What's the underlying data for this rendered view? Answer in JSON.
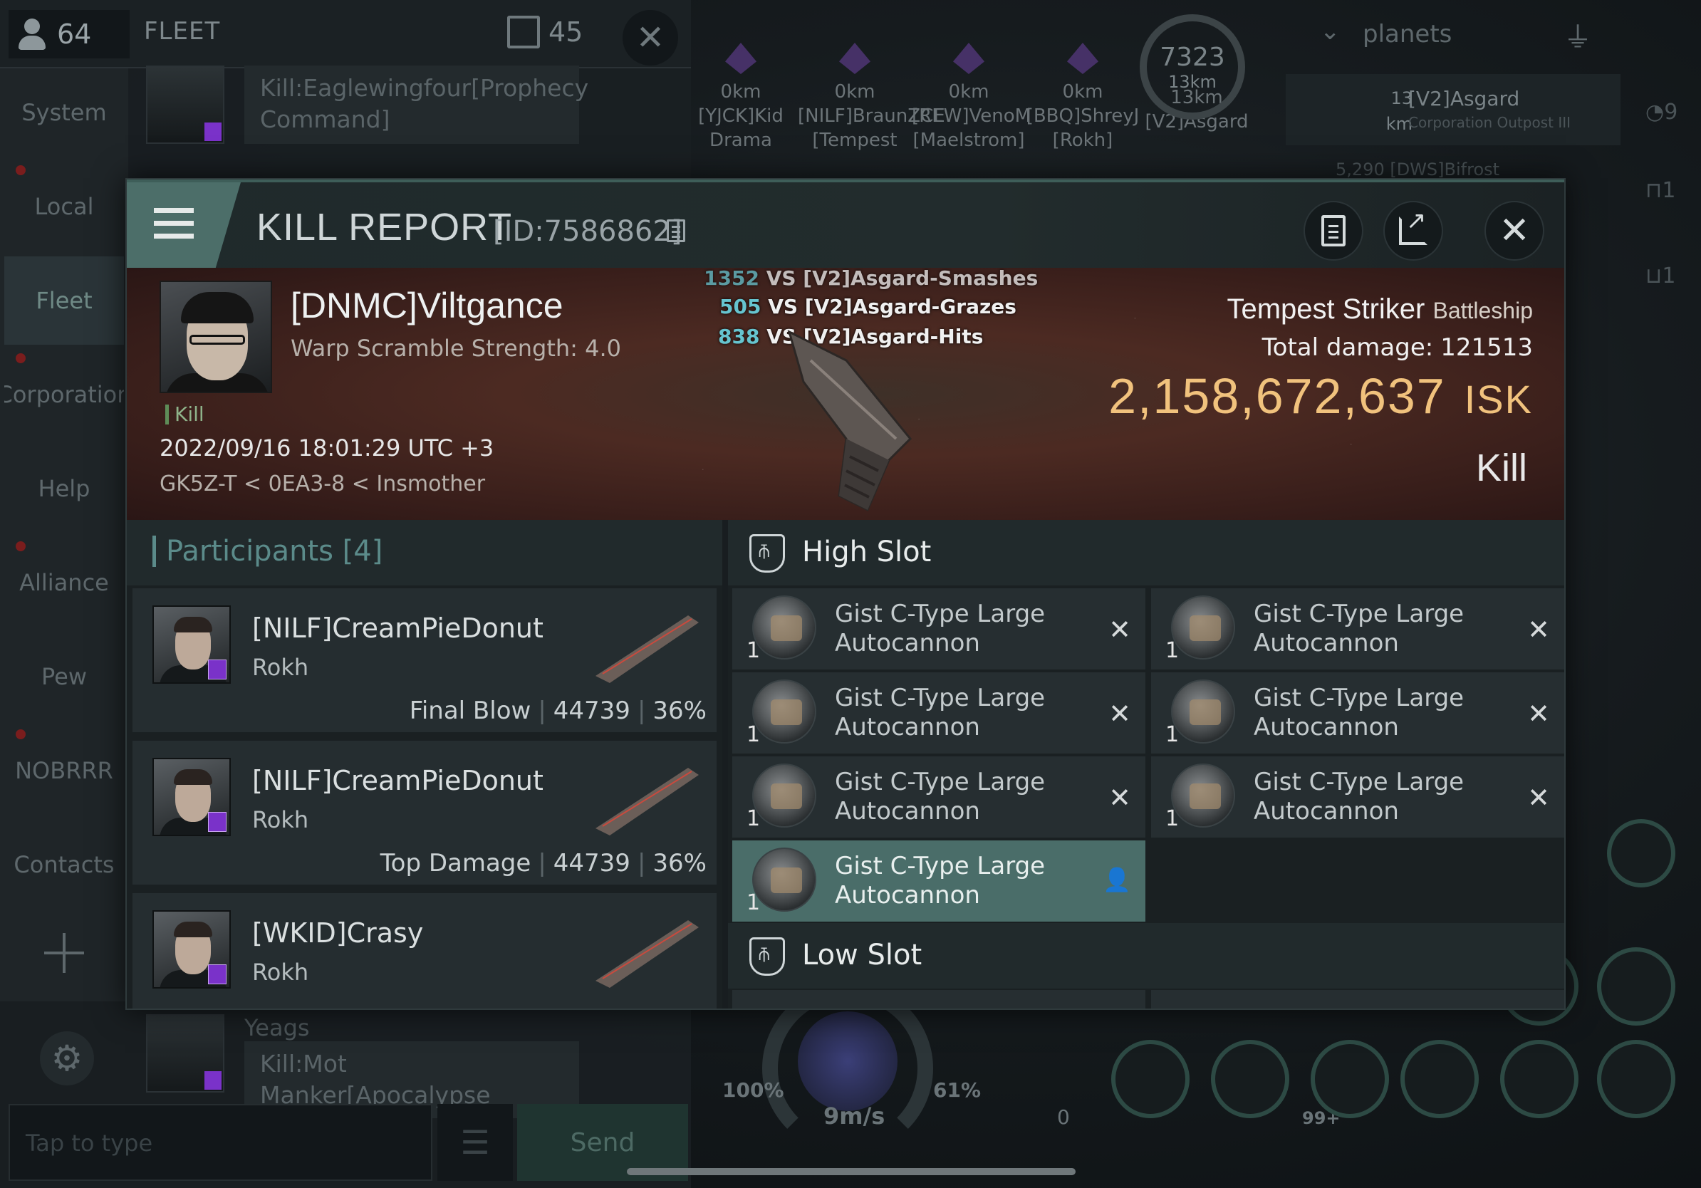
{
  "chat": {
    "member_count": "64",
    "channel_title": "FLEET",
    "unread_count": "45",
    "close_icon": "✕",
    "tabs": [
      {
        "label": "System"
      },
      {
        "label": "Local"
      },
      {
        "label": "Fleet"
      },
      {
        "label": "Corporation"
      },
      {
        "label": "Help"
      },
      {
        "label": "Alliance"
      },
      {
        "label": "Pew"
      },
      {
        "label": "NOBRRR"
      },
      {
        "label": "Contacts"
      }
    ],
    "messages": [
      {
        "text": "Kill:Eaglewingfour[Prophecy Command]"
      },
      {
        "sender": "Yeags",
        "text": "Kill:Mot Manker[Apocalypse"
      }
    ],
    "input_placeholder": "Tap to type",
    "menu_icon": "☰",
    "send_label": "Send",
    "settings_icon": "⚙"
  },
  "overview": {
    "filter_label": "planets",
    "entries": [
      {
        "distance": "13",
        "unit": "km",
        "name": "[V2]Asgard",
        "type": "Corporation Outpost III"
      },
      {
        "distance": "5,290",
        "name": "[DWS]Bifrost"
      }
    ],
    "right_counts": [
      "9",
      "1",
      "1"
    ]
  },
  "targets": [
    {
      "dist": "0km",
      "name": "[YJCK]Kid Drama"
    },
    {
      "dist": "0km",
      "name": "[NILF]BraunZCE [Tempest"
    },
    {
      "dist": "0km",
      "name": "[REW]VenoM [Maelstrom]"
    },
    {
      "dist": "0km",
      "name": "[BBQ]ShreyJ [Rokh]"
    },
    {
      "dist": "13km",
      "name": "[V2]Asgard"
    }
  ],
  "speed_gauge": {
    "value": "7323",
    "unit": "13km"
  },
  "hud": {
    "speed": "9m/s",
    "left_pct": "100%",
    "right_pct": "61%",
    "zero": "0",
    "badge": "99+"
  },
  "kill_report": {
    "title": "KILL REPORT",
    "id": "[ID:7586862]",
    "victim": {
      "name": "[DNMC]Viltgance",
      "scramble": "Warp Scramble Strength: 4.0",
      "tag": "Kill",
      "datetime": "2022/09/16 18:01:29 UTC +3",
      "location": "GK5Z-T < 0EA3-8 < Insmother"
    },
    "damage_lines": [
      {
        "num": "1352",
        "text": "VS [V2]Asgard-Smashes"
      },
      {
        "num": "505",
        "text": "VS [V2]Asgard-Grazes"
      },
      {
        "num": "838",
        "text": "VS [V2]Asgard-Hits"
      }
    ],
    "ship": {
      "name": "Tempest Striker",
      "class": "Battleship",
      "total_damage_label": "Total damage:",
      "total_damage": "121513",
      "isk": "2,158,672,637",
      "isk_unit": "ISK",
      "result": "Kill"
    },
    "participants_label": "Participants [4]",
    "participants": [
      {
        "name": "[NILF]CreamPieDonut",
        "ship": "Rokh",
        "role": "Final Blow",
        "damage": "44739",
        "pct": "36%"
      },
      {
        "name": "[NILF]CreamPieDonut",
        "ship": "Rokh",
        "role": "Top Damage",
        "damage": "44739",
        "pct": "36%"
      },
      {
        "name": "[WKID]Crasy",
        "ship": "Rokh",
        "role": "",
        "damage": "",
        "pct": ""
      }
    ],
    "high_slot_label": "High Slot",
    "low_slot_label": "Low Slot",
    "high_slot_modules": [
      {
        "name": "Gist C-Type Large Autocannon",
        "qty": "1",
        "state": "destroyed"
      },
      {
        "name": "Gist C-Type Large Autocannon",
        "qty": "1",
        "state": "destroyed"
      },
      {
        "name": "Gist C-Type Large Autocannon",
        "qty": "1",
        "state": "destroyed"
      },
      {
        "name": "Gist C-Type Large Autocannon",
        "qty": "1",
        "state": "destroyed"
      },
      {
        "name": "Gist C-Type Large Autocannon",
        "qty": "1",
        "state": "destroyed"
      },
      {
        "name": "Gist C-Type Large Autocannon",
        "qty": "1",
        "state": "destroyed"
      },
      {
        "name": "Gist C-Type Large Autocannon",
        "qty": "1",
        "state": "dropped"
      }
    ],
    "icons": {
      "destroyed": "✕",
      "dropped": "👤",
      "close": "✕"
    }
  }
}
